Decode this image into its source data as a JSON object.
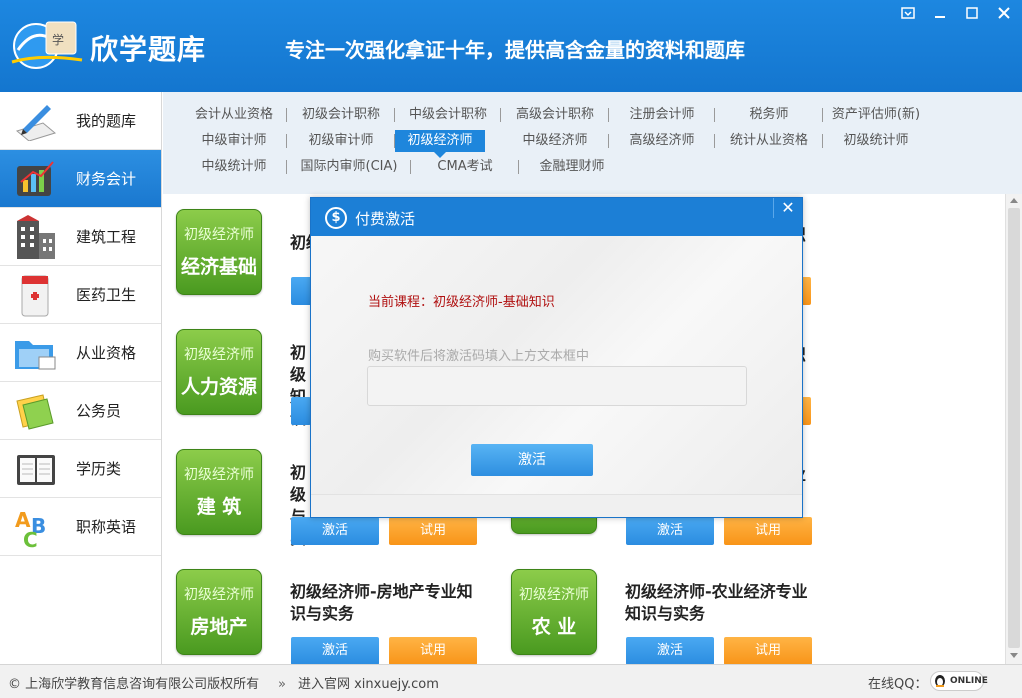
{
  "header": {
    "app_title": "欣学题库",
    "slogan": "专注一次强化拿证十年，提供高含金量的资料和题库",
    "window_controls": [
      "restore-icon",
      "minimize-icon",
      "maximize-icon",
      "close-icon"
    ]
  },
  "sidebar": {
    "items": [
      {
        "label": "我的题库",
        "icon": "pencil-paper-icon"
      },
      {
        "label": "财务会计",
        "icon": "calculator-chart-icon",
        "active": true
      },
      {
        "label": "建筑工程",
        "icon": "building-icon"
      },
      {
        "label": "医药卫生",
        "icon": "medicine-box-icon"
      },
      {
        "label": "从业资格",
        "icon": "folder-icon"
      },
      {
        "label": "公务员",
        "icon": "documents-icon"
      },
      {
        "label": "学历类",
        "icon": "notebook-icon"
      },
      {
        "label": "职称英语",
        "icon": "abc-icon"
      }
    ]
  },
  "tabs": {
    "row1": [
      "会计从业资格",
      "初级会计职称",
      "中级会计职称",
      "高级会计职称",
      "注册会计师",
      "税务师",
      "资产评估师(新)"
    ],
    "row2": [
      "中级审计师",
      "初级审计师",
      "初级经济师",
      "中级经济师",
      "高级经济师",
      "统计从业资格",
      "初级统计师"
    ],
    "row3": [
      "中级统计师",
      "国际内审师(CIA)",
      "CMA考试",
      "金融理财师"
    ],
    "active": "初级经济师"
  },
  "courses": [
    {
      "badge_top": "初级经济师",
      "badge_bottom": "经济基础",
      "title": "初级",
      "activate": "激活",
      "trial": "试用"
    },
    {
      "badge_top": "",
      "badge_bottom": "",
      "title": "识",
      "activate": "激活",
      "trial": "试用"
    },
    {
      "badge_top": "初级经济师",
      "badge_bottom": "人力资源",
      "title": "初级 知识",
      "activate": "激活",
      "trial": "试用"
    },
    {
      "badge_top": "",
      "badge_bottom": "",
      "title": "识",
      "activate": "激活",
      "trial": "试用"
    },
    {
      "badge_top": "初级经济师",
      "badge_bottom": "建 筑",
      "title": "初级 与实",
      "activate": "激活",
      "trial": "试用"
    },
    {
      "badge_top": "",
      "badge_bottom": "",
      "title": "业",
      "activate": "激活",
      "trial": "试用"
    },
    {
      "badge_top": "初级经济师",
      "badge_bottom": "房地产",
      "title": "初级经济师-房地产专业知识与实务",
      "activate": "激活",
      "trial": "试用"
    },
    {
      "badge_top": "初级经济师",
      "badge_bottom": "农 业",
      "title": "初级经济师-农业经济专业知识与实务",
      "activate": "激活",
      "trial": "试用"
    }
  ],
  "footer": {
    "copyright": "© 上海欣学教育信息咨询有限公司版权所有",
    "website": "进入官网 xinxuejy.com",
    "online_qq": "在线QQ：",
    "qq_badge": "ONLINE"
  },
  "dialog": {
    "title": "付费激活",
    "title_icon": "$",
    "close": "✕",
    "current_course": "当前课程：初级经济师-基础知识",
    "hint": "购买软件后将激活码填入上方文本框中",
    "code_value": "",
    "activate_label": "激活"
  }
}
